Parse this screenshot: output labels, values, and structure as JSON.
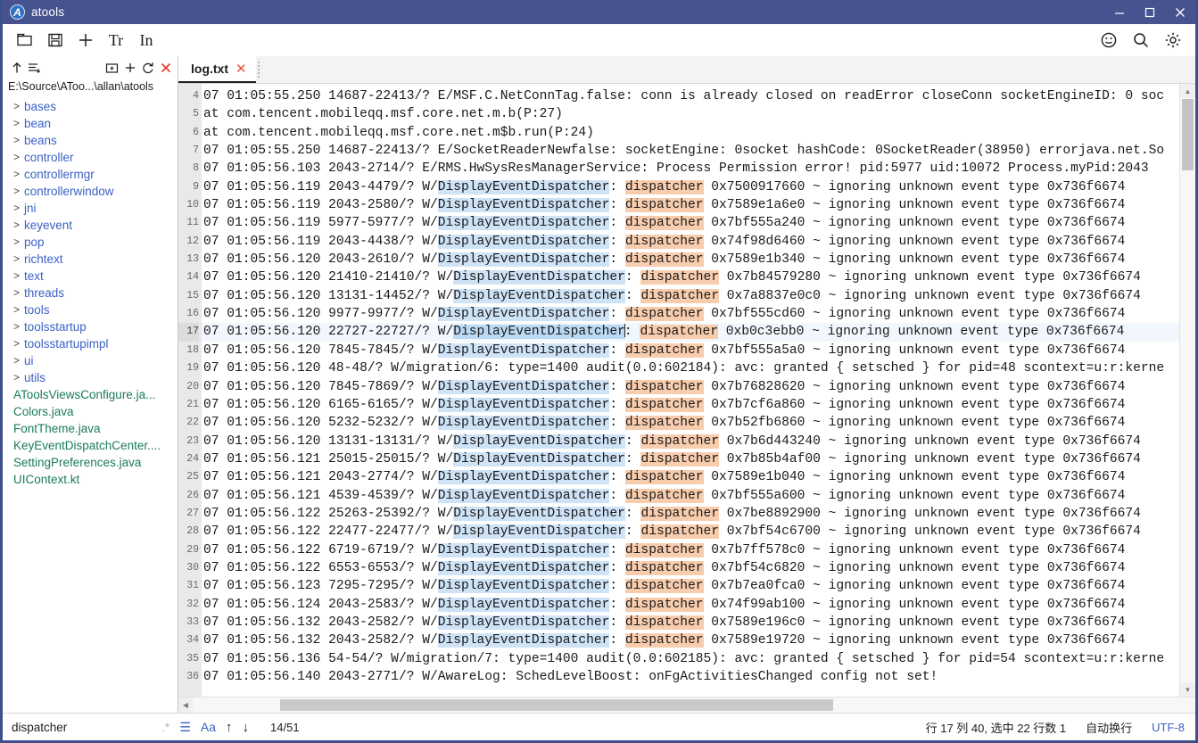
{
  "window": {
    "title": "atools",
    "logo_letter": "A",
    "controls": {
      "minimize": "minimize-icon",
      "maximize": "maximize-icon",
      "close": "close-icon"
    },
    "accent": "#46538f"
  },
  "toolbar": {
    "items": [
      {
        "name": "open-folder-icon",
        "label": ""
      },
      {
        "name": "save-icon",
        "label": ""
      },
      {
        "name": "add-icon",
        "label": "+"
      },
      {
        "name": "font-size-icon",
        "label": "Tr"
      },
      {
        "name": "line-number-icon",
        "label": "In"
      }
    ],
    "right_items": [
      {
        "name": "emoji-icon"
      },
      {
        "name": "search-icon"
      },
      {
        "name": "gear-icon"
      }
    ]
  },
  "sidebar": {
    "tools": [
      {
        "name": "up-arrow-icon"
      },
      {
        "name": "collapse-all-icon"
      },
      {
        "name": "new-folder-icon"
      },
      {
        "name": "new-file-icon",
        "label": "+"
      },
      {
        "name": "refresh-icon"
      },
      {
        "name": "close-icon",
        "label": "✕"
      }
    ],
    "path": "E:\\Source\\AToo...\\allan\\atools",
    "folders": [
      "bases",
      "bean",
      "beans",
      "controller",
      "controllermgr",
      "controllerwindow",
      "jni",
      "keyevent",
      "pop",
      "richtext",
      "text",
      "threads",
      "tools",
      "toolsstartup",
      "toolsstartupimpl",
      "ui",
      "utils"
    ],
    "files": [
      "AToolsViewsConfigure.ja...",
      "Colors.java",
      "FontTheme.java",
      "KeyEventDispatchCenter....",
      "SettingPreferences.java",
      "UIContext.kt"
    ],
    "expander": ">"
  },
  "tabs": [
    {
      "label": "log.txt",
      "close": "✕",
      "active": true
    }
  ],
  "editor": {
    "first_line_number": 4,
    "active_line": 17,
    "search_term_blue": "DisplayEventDispatcher",
    "search_term_orange": "dispatcher",
    "lines": [
      {
        "n": 4,
        "pre": "07 01:05:55.250 14687-22413/? E/MSF.C.NetConnTag.false: conn is already closed on readError closeConn socketEngineID: 0 soc"
      },
      {
        "n": 5,
        "pre": "at com.tencent.mobileqq.msf.core.net.m.b(P:27)"
      },
      {
        "n": 6,
        "pre": "at com.tencent.mobileqq.msf.core.net.m$b.run(P:24)"
      },
      {
        "n": 7,
        "pre": "07 01:05:55.250 14687-22413/? E/SocketReaderNewfalse: socketEngine: 0socket hashCode: 0SocketReader(38950) errorjava.net.So"
      },
      {
        "n": 8,
        "pre": "07 01:05:56.103 2043-2714/? E/RMS.HwSysResManagerService: Process Permission error! pid:5977 uid:10072 Process.myPid:2043"
      },
      {
        "n": 9,
        "pre": "07 01:05:56.119 2043-4479/? W/",
        "mid": ": ",
        "addr": " 0x7500917660 ~ ignoring unknown event type 0x736f6674"
      },
      {
        "n": 10,
        "pre": "07 01:05:56.119 2043-2580/? W/",
        "mid": ": ",
        "addr": " 0x7589e1a6e0 ~ ignoring unknown event type 0x736f6674"
      },
      {
        "n": 11,
        "pre": "07 01:05:56.119 5977-5977/? W/",
        "mid": ": ",
        "addr": " 0x7bf555a240 ~ ignoring unknown event type 0x736f6674"
      },
      {
        "n": 12,
        "pre": "07 01:05:56.119 2043-4438/? W/",
        "mid": ": ",
        "addr": " 0x74f98d6460 ~ ignoring unknown event type 0x736f6674"
      },
      {
        "n": 13,
        "pre": "07 01:05:56.120 2043-2610/? W/",
        "mid": ": ",
        "addr": " 0x7589e1b340 ~ ignoring unknown event type 0x736f6674"
      },
      {
        "n": 14,
        "pre": "07 01:05:56.120 21410-21410/? W/",
        "mid": ": ",
        "addr": " 0x7b84579280 ~ ignoring unknown event type 0x736f6674"
      },
      {
        "n": 15,
        "pre": "07 01:05:56.120 13131-14452/? W/",
        "mid": ": ",
        "addr": " 0x7a8837e0c0 ~ ignoring unknown event type 0x736f6674"
      },
      {
        "n": 16,
        "pre": "07 01:05:56.120 9977-9977/? W/",
        "mid": ": ",
        "addr": " 0x7bf555cd60 ~ ignoring unknown event type 0x736f6674"
      },
      {
        "n": 17,
        "pre": "07 01:05:56.120 22727-22727/? W/",
        "mid": ": ",
        "addr": " 0xb0c3ebb0 ~ ignoring unknown event type 0x736f6674",
        "current": true
      },
      {
        "n": 18,
        "pre": "07 01:05:56.120 7845-7845/? W/",
        "mid": ": ",
        "addr": " 0x7bf555a5a0 ~ ignoring unknown event type 0x736f6674"
      },
      {
        "n": 19,
        "pre": "07 01:05:56.120 48-48/? W/migration/6: type=1400 audit(0.0:602184): avc: granted { setsched } for pid=48 scontext=u:r:kerne"
      },
      {
        "n": 20,
        "pre": "07 01:05:56.120 7845-7869/? W/",
        "mid": ": ",
        "addr": " 0x7b76828620 ~ ignoring unknown event type 0x736f6674"
      },
      {
        "n": 21,
        "pre": "07 01:05:56.120 6165-6165/? W/",
        "mid": ": ",
        "addr": " 0x7b7cf6a860 ~ ignoring unknown event type 0x736f6674"
      },
      {
        "n": 22,
        "pre": "07 01:05:56.120 5232-5232/? W/",
        "mid": ": ",
        "addr": " 0x7b52fb6860 ~ ignoring unknown event type 0x736f6674"
      },
      {
        "n": 23,
        "pre": "07 01:05:56.120 13131-13131/? W/",
        "mid": ": ",
        "addr": " 0x7b6d443240 ~ ignoring unknown event type 0x736f6674"
      },
      {
        "n": 24,
        "pre": "07 01:05:56.121 25015-25015/? W/",
        "mid": ": ",
        "addr": " 0x7b85b4af00 ~ ignoring unknown event type 0x736f6674"
      },
      {
        "n": 25,
        "pre": "07 01:05:56.121 2043-2774/? W/",
        "mid": ": ",
        "addr": " 0x7589e1b040 ~ ignoring unknown event type 0x736f6674"
      },
      {
        "n": 26,
        "pre": "07 01:05:56.121 4539-4539/? W/",
        "mid": ": ",
        "addr": " 0x7bf555a600 ~ ignoring unknown event type 0x736f6674"
      },
      {
        "n": 27,
        "pre": "07 01:05:56.122 25263-25392/? W/",
        "mid": ": ",
        "addr": " 0x7be8892900 ~ ignoring unknown event type 0x736f6674"
      },
      {
        "n": 28,
        "pre": "07 01:05:56.122 22477-22477/? W/",
        "mid": ": ",
        "addr": " 0x7bf54c6700 ~ ignoring unknown event type 0x736f6674"
      },
      {
        "n": 29,
        "pre": "07 01:05:56.122 6719-6719/? W/",
        "mid": ": ",
        "addr": " 0x7b7ff578c0 ~ ignoring unknown event type 0x736f6674"
      },
      {
        "n": 30,
        "pre": "07 01:05:56.122 6553-6553/? W/",
        "mid": ": ",
        "addr": " 0x7bf54c6820 ~ ignoring unknown event type 0x736f6674"
      },
      {
        "n": 31,
        "pre": "07 01:05:56.123 7295-7295/? W/",
        "mid": ": ",
        "addr": " 0x7b7ea0fca0 ~ ignoring unknown event type 0x736f6674"
      },
      {
        "n": 32,
        "pre": "07 01:05:56.124 2043-2583/? W/",
        "mid": ": ",
        "addr": " 0x74f99ab100 ~ ignoring unknown event type 0x736f6674"
      },
      {
        "n": 33,
        "pre": "07 01:05:56.132 2043-2582/? W/",
        "mid": ": ",
        "addr": " 0x7589e196c0 ~ ignoring unknown event type 0x736f6674"
      },
      {
        "n": 34,
        "pre": "07 01:05:56.132 2043-2582/? W/",
        "mid": ": ",
        "addr": " 0x7589e19720 ~ ignoring unknown event type 0x736f6674"
      },
      {
        "n": 35,
        "pre": "07 01:05:56.136 54-54/? W/migration/7: type=1400 audit(0.0:602185): avc: granted { setsched } for pid=54 scontext=u:r:kerne"
      },
      {
        "n": 36,
        "pre": "07 01:05:56.140 2043-2771/? W/AwareLog: SchedLevelBoost: onFgActivitiesChanged config not set!"
      }
    ]
  },
  "statusbar": {
    "find_value": "dispatcher",
    "find_placeholder": "",
    "icons": [
      {
        "name": "regex-icon",
        "glyph": ".*"
      },
      {
        "name": "match-list-icon",
        "glyph": "☰"
      },
      {
        "name": "match-case-icon",
        "glyph": "Aa"
      },
      {
        "name": "find-prev-icon",
        "glyph": "↑"
      },
      {
        "name": "find-next-icon",
        "glyph": "↓"
      }
    ],
    "match_count": "14/51",
    "caret_info": "行 17 列 40, 选中 22 行数 1",
    "wrap_label": "自动换行",
    "encoding": "UTF-8"
  }
}
